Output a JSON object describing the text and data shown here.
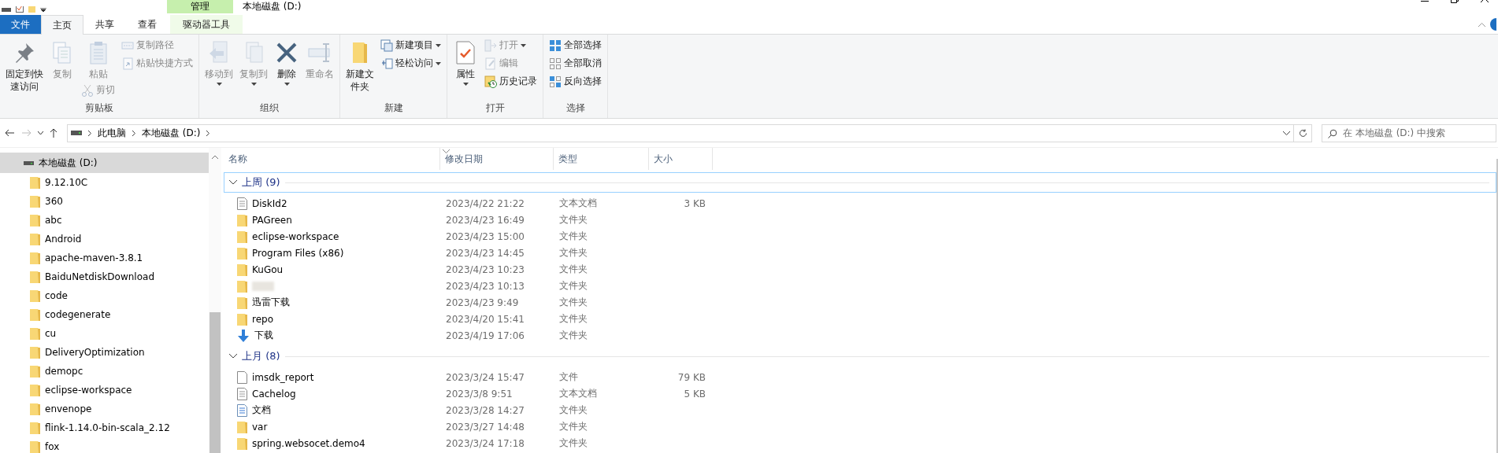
{
  "window": {
    "title": "本地磁盘 (D:)",
    "context_tab_group": "管理"
  },
  "ribbon_tabs": [
    {
      "label": "文件",
      "kind": "file",
      "selected": false
    },
    {
      "label": "主页",
      "kind": "tab",
      "selected": true
    },
    {
      "label": "共享",
      "kind": "tab",
      "selected": false
    },
    {
      "label": "查看",
      "kind": "tab",
      "selected": false
    },
    {
      "label": "驱动器工具",
      "kind": "context",
      "selected": false
    }
  ],
  "ribbon_groups": [
    {
      "label": "剪贴板",
      "columns": [
        [
          {
            "label": "固定到快速访问",
            "kind": "large",
            "disabled": false,
            "dropdown": false
          }
        ],
        [
          {
            "label": "复制",
            "kind": "large",
            "disabled": true,
            "dropdown": false
          }
        ],
        [
          {
            "label": "粘贴",
            "kind": "large",
            "disabled": true,
            "dropdown": false
          },
          {
            "label": "剪切",
            "kind": "small",
            "disabled": true,
            "dropdown": false
          }
        ],
        [
          {
            "label": "复制路径",
            "kind": "small",
            "disabled": true,
            "dropdown": false
          },
          {
            "label": "粘贴快捷方式",
            "kind": "small",
            "disabled": true,
            "dropdown": false
          }
        ]
      ]
    },
    {
      "label": "组织",
      "columns": [
        [
          {
            "label": "移动到",
            "kind": "large",
            "disabled": true,
            "dropdown": true
          }
        ],
        [
          {
            "label": "复制到",
            "kind": "large",
            "disabled": true,
            "dropdown": true
          }
        ],
        [
          {
            "label": "删除",
            "kind": "large",
            "disabled": false,
            "dropdown": true
          }
        ],
        [
          {
            "label": "重命名",
            "kind": "large",
            "disabled": true,
            "dropdown": false
          }
        ]
      ]
    },
    {
      "label": "新建",
      "columns": [
        [
          {
            "label": "新建文件夹",
            "kind": "large",
            "disabled": false,
            "dropdown": false
          }
        ],
        [
          {
            "label": "新建项目",
            "kind": "small",
            "disabled": false,
            "dropdown": true
          },
          {
            "label": "轻松访问",
            "kind": "small",
            "disabled": false,
            "dropdown": true
          }
        ]
      ]
    },
    {
      "label": "打开",
      "columns": [
        [
          {
            "label": "属性",
            "kind": "large",
            "disabled": false,
            "dropdown": true
          }
        ],
        [
          {
            "label": "打开",
            "kind": "small",
            "disabled": true,
            "dropdown": true
          },
          {
            "label": "编辑",
            "kind": "small",
            "disabled": true,
            "dropdown": false
          },
          {
            "label": "历史记录",
            "kind": "small",
            "disabled": false,
            "dropdown": false
          }
        ]
      ]
    },
    {
      "label": "选择",
      "columns": [
        [
          {
            "label": "全部选择",
            "kind": "small",
            "disabled": false,
            "dropdown": false
          },
          {
            "label": "全部取消",
            "kind": "small",
            "disabled": false,
            "dropdown": false
          },
          {
            "label": "反向选择",
            "kind": "small",
            "disabled": false,
            "dropdown": false
          }
        ]
      ]
    }
  ],
  "address_bar": {
    "forward_disabled": true,
    "crumbs": [
      "此电脑",
      "本地磁盘 (D:)"
    ]
  },
  "search": {
    "placeholder": "在 本地磁盘 (D:) 中搜索"
  },
  "navigation": {
    "items": [
      {
        "label": "本地磁盘 (D:)",
        "selected": true,
        "children": [
          {
            "label": "9.12.10C",
            "selected": false
          },
          {
            "label": "360",
            "selected": false
          },
          {
            "label": "abc",
            "selected": false
          },
          {
            "label": "Android",
            "selected": false
          },
          {
            "label": "apache-maven-3.8.1",
            "selected": false
          },
          {
            "label": "BaiduNetdiskDownload",
            "selected": false
          },
          {
            "label": "code",
            "selected": false
          },
          {
            "label": "codegenerate",
            "selected": false
          },
          {
            "label": "cu",
            "selected": false
          },
          {
            "label": "DeliveryOptimization",
            "selected": false
          },
          {
            "label": "demopc",
            "selected": false
          },
          {
            "label": "eclipse-workspace",
            "selected": false
          },
          {
            "label": "envenope",
            "selected": false
          },
          {
            "label": "flink-1.14.0-bin-scala_2.12",
            "selected": false
          },
          {
            "label": "fox",
            "selected": false
          }
        ]
      }
    ]
  },
  "file_list": {
    "columns": [
      "名称",
      "修改日期",
      "类型",
      "大小"
    ],
    "groups": [
      {
        "label": "上周 (9)",
        "focused": true,
        "rows": [
          {
            "name": "DiskId2",
            "date": "2023/4/22 21:22",
            "type": "文本文档",
            "size": "3 KB",
            "kind": "text",
            "blurred": false
          },
          {
            "name": "PAGreen",
            "date": "2023/4/23 16:49",
            "type": "文件夹",
            "kind": "folder",
            "blurred": false
          },
          {
            "name": "eclipse-workspace",
            "date": "2023/4/23 15:00",
            "type": "文件夹",
            "kind": "folder",
            "blurred": false
          },
          {
            "name": "Program Files (x86)",
            "date": "2023/4/23 14:45",
            "type": "文件夹",
            "kind": "folder",
            "blurred": false
          },
          {
            "name": "KuGou",
            "date": "2023/4/23 10:23",
            "type": "文件夹",
            "kind": "folder",
            "blurred": false
          },
          {
            "date": "2023/4/23 10:13",
            "type": "文件夹",
            "kind": "folder",
            "blurred": true
          },
          {
            "name": "迅雷下载",
            "date": "2023/4/23 9:49",
            "type": "文件夹",
            "kind": "folder",
            "blurred": false
          },
          {
            "name": "repo",
            "date": "2023/4/20 15:41",
            "type": "文件夹",
            "kind": "folder",
            "blurred": false
          },
          {
            "name": "下载",
            "date": "2023/4/19 17:06",
            "type": "文件夹",
            "kind": "download",
            "blurred": false
          }
        ]
      },
      {
        "label": "上月 (8)",
        "focused": false,
        "rows": [
          {
            "name": "imsdk_report",
            "date": "2023/3/24 15:47",
            "type": "文件",
            "size": "79 KB",
            "kind": "file",
            "blurred": false
          },
          {
            "name": "Cachelog",
            "date": "2023/3/8 9:51",
            "type": "文本文档",
            "size": "5 KB",
            "kind": "text",
            "blurred": false
          },
          {
            "name": "文档",
            "date": "2023/3/28 14:27",
            "type": "文件夹",
            "kind": "doc",
            "blurred": false
          },
          {
            "name": "var",
            "date": "2023/3/27 14:48",
            "type": "文件夹",
            "kind": "folder",
            "blurred": false
          },
          {
            "name": "spring.websocet.demo4",
            "date": "2023/3/24 17:18",
            "type": "文件夹",
            "kind": "folder",
            "blurred": false
          }
        ]
      }
    ]
  }
}
